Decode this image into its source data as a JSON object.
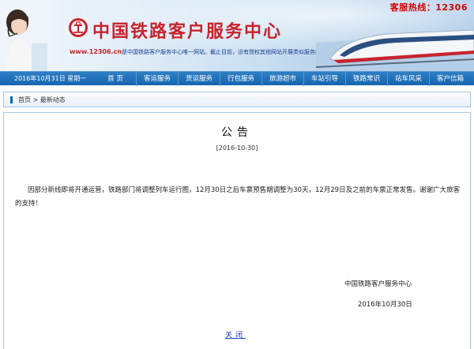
{
  "header": {
    "hotline_label": "客服热线：12306",
    "site_title": "中国铁路客户服务中心",
    "site_url": "www.12306.cn",
    "site_statement": "是中国铁路客户服务中心唯一网站。截止目前，没有授权其他网站开展类似服务内容，敬请广大"
  },
  "nav": {
    "date": "2016年10月31日  星期一",
    "items": [
      {
        "label": "首  页"
      },
      {
        "label": "客运服务"
      },
      {
        "label": "货运服务"
      },
      {
        "label": "行包服务"
      },
      {
        "label": "旅游超市"
      },
      {
        "label": "车站引导"
      },
      {
        "label": "铁路常识"
      },
      {
        "label": "站车风采"
      },
      {
        "label": "客户信箱"
      }
    ]
  },
  "breadcrumb": {
    "home": "首页",
    "separator": ">",
    "current": "最新动态"
  },
  "notice": {
    "title": "公告",
    "date": "[2016-10-30]",
    "body": "因部分新线即将开通运营，铁路部门将调整列车运行图，12月30日之后车票预售期调整为30天，12月29日及之前的车票正常发售。谢谢广大旅客的支持！",
    "signature_org": "中国铁路客户服务中心",
    "signature_date": "2016年10月30日",
    "close_label": "关闭"
  },
  "colors": {
    "brand_red": "#c8232c",
    "nav_blue": "#1565b0",
    "link_blue": "#1a3dc8"
  }
}
